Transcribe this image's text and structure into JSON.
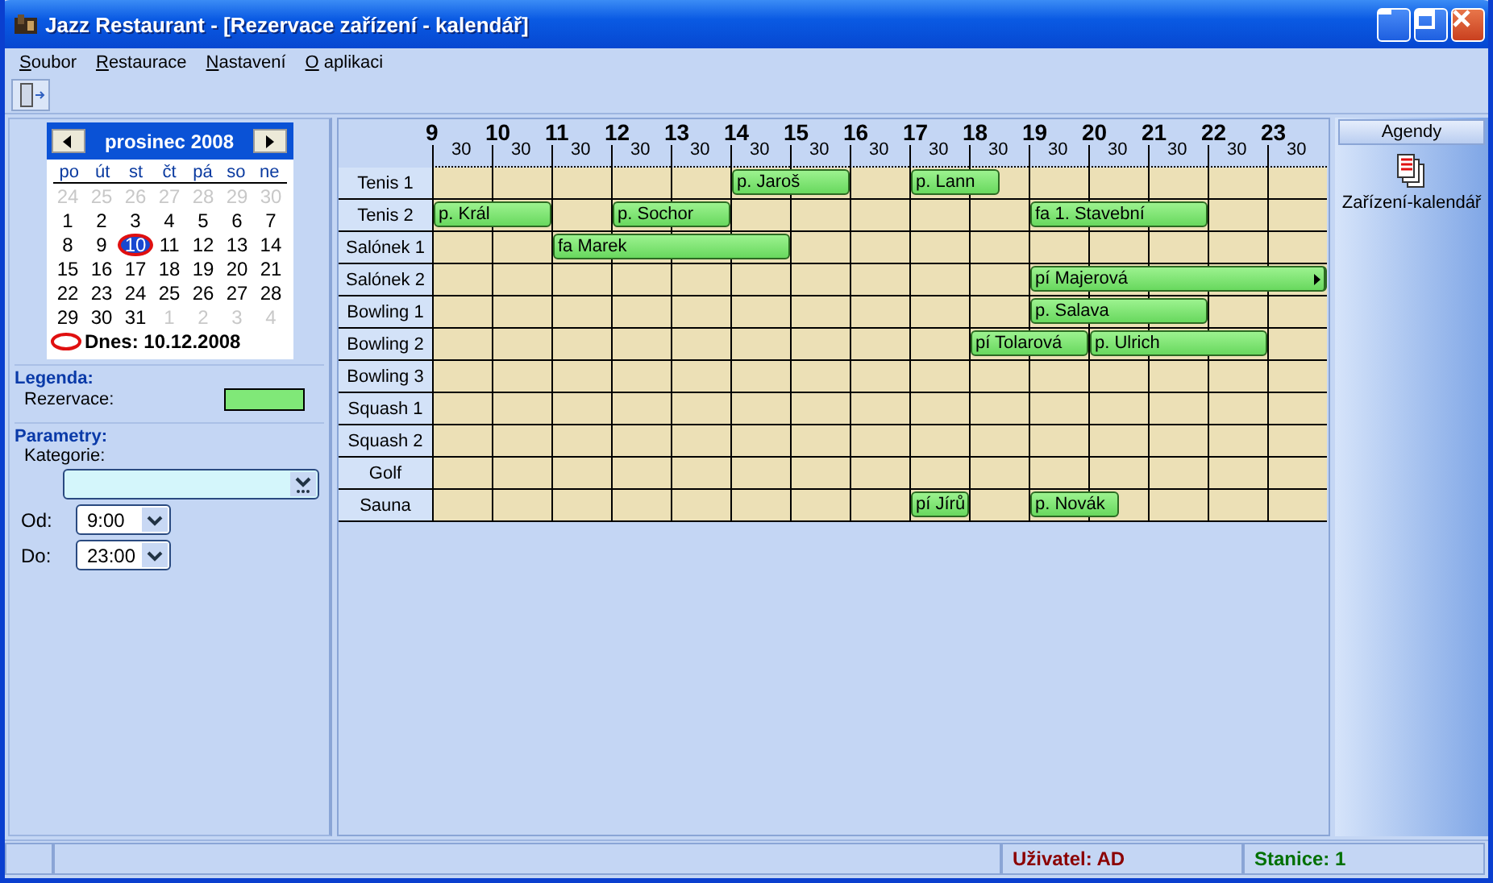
{
  "window": {
    "title": "Jazz Restaurant - [Rezervace zařízení - kalendář]"
  },
  "menu": [
    "Soubor",
    "Restaurace",
    "Nastavení",
    "O aplikaci"
  ],
  "calendar": {
    "month": "prosinec 2008",
    "weekdays": [
      "po",
      "út",
      "st",
      "čt",
      "pá",
      "so",
      "ne"
    ],
    "weeks": [
      [
        {
          "day": "24",
          "other_month": true,
          "selected": false
        },
        {
          "day": "25",
          "other_month": true,
          "selected": false
        },
        {
          "day": "26",
          "other_month": true,
          "selected": false
        },
        {
          "day": "27",
          "other_month": true,
          "selected": false
        },
        {
          "day": "28",
          "other_month": true,
          "selected": false
        },
        {
          "day": "29",
          "other_month": true,
          "selected": false
        },
        {
          "day": "30",
          "other_month": true,
          "selected": false
        }
      ],
      [
        {
          "day": "1",
          "other_month": false,
          "selected": false
        },
        {
          "day": "2",
          "other_month": false,
          "selected": false
        },
        {
          "day": "3",
          "other_month": false,
          "selected": false
        },
        {
          "day": "4",
          "other_month": false,
          "selected": false
        },
        {
          "day": "5",
          "other_month": false,
          "selected": false
        },
        {
          "day": "6",
          "other_month": false,
          "selected": false
        },
        {
          "day": "7",
          "other_month": false,
          "selected": false
        }
      ],
      [
        {
          "day": "8",
          "other_month": false,
          "selected": false
        },
        {
          "day": "9",
          "other_month": false,
          "selected": false
        },
        {
          "day": "10",
          "other_month": false,
          "selected": true
        },
        {
          "day": "11",
          "other_month": false,
          "selected": false
        },
        {
          "day": "12",
          "other_month": false,
          "selected": false
        },
        {
          "day": "13",
          "other_month": false,
          "selected": false
        },
        {
          "day": "14",
          "other_month": false,
          "selected": false
        }
      ],
      [
        {
          "day": "15",
          "other_month": false,
          "selected": false
        },
        {
          "day": "16",
          "other_month": false,
          "selected": false
        },
        {
          "day": "17",
          "other_month": false,
          "selected": false
        },
        {
          "day": "18",
          "other_month": false,
          "selected": false
        },
        {
          "day": "19",
          "other_month": false,
          "selected": false
        },
        {
          "day": "20",
          "other_month": false,
          "selected": false
        },
        {
          "day": "21",
          "other_month": false,
          "selected": false
        }
      ],
      [
        {
          "day": "22",
          "other_month": false,
          "selected": false
        },
        {
          "day": "23",
          "other_month": false,
          "selected": false
        },
        {
          "day": "24",
          "other_month": false,
          "selected": false
        },
        {
          "day": "25",
          "other_month": false,
          "selected": false
        },
        {
          "day": "26",
          "other_month": false,
          "selected": false
        },
        {
          "day": "27",
          "other_month": false,
          "selected": false
        },
        {
          "day": "28",
          "other_month": false,
          "selected": false
        }
      ],
      [
        {
          "day": "29",
          "other_month": false,
          "selected": false
        },
        {
          "day": "30",
          "other_month": false,
          "selected": false
        },
        {
          "day": "31",
          "other_month": false,
          "selected": false
        },
        {
          "day": "1",
          "other_month": true,
          "selected": false
        },
        {
          "day": "2",
          "other_month": true,
          "selected": false
        },
        {
          "day": "3",
          "other_month": true,
          "selected": false
        },
        {
          "day": "4",
          "other_month": true,
          "selected": false
        }
      ]
    ],
    "today": "Dnes: 10.12.2008"
  },
  "legend": {
    "title": "Legenda:",
    "items": [
      {
        "label": "Rezervace:",
        "color": "#80e878"
      }
    ]
  },
  "parameters": {
    "title": "Parametry:",
    "category_label": "Kategorie:",
    "from_label": "Od:",
    "from_value": "9:00",
    "to_label": "Do:",
    "to_value": "23:00"
  },
  "schedule": {
    "hours": [
      {
        "hour": "9",
        "half": "30"
      },
      {
        "hour": "10",
        "half": "30"
      },
      {
        "hour": "11",
        "half": "30"
      },
      {
        "hour": "12",
        "half": "30"
      },
      {
        "hour": "13",
        "half": "30"
      },
      {
        "hour": "14",
        "half": "30"
      },
      {
        "hour": "15",
        "half": "30"
      },
      {
        "hour": "16",
        "half": "30"
      },
      {
        "hour": "17",
        "half": "30"
      },
      {
        "hour": "18",
        "half": "30"
      },
      {
        "hour": "19",
        "half": "30"
      },
      {
        "hour": "20",
        "half": "30"
      },
      {
        "hour": "21",
        "half": "30"
      },
      {
        "hour": "22",
        "half": "30"
      },
      {
        "hour": "23",
        "half": "30"
      }
    ],
    "rows": [
      {
        "name": "Tenis 1",
        "reservations": [
          {
            "label": "p. Jaroš",
            "continues": false
          },
          {
            "label": "p. Lann",
            "continues": false
          }
        ]
      },
      {
        "name": "Tenis 2",
        "reservations": [
          {
            "label": "p. Král",
            "continues": false
          },
          {
            "label": "p. Sochor",
            "continues": false
          },
          {
            "label": "fa 1. Stavební",
            "continues": false
          }
        ]
      },
      {
        "name": "Salónek 1",
        "reservations": [
          {
            "label": "fa Marek",
            "continues": false
          }
        ]
      },
      {
        "name": "Salónek 2",
        "reservations": [
          {
            "label": "pí Majerová",
            "continues": true
          }
        ]
      },
      {
        "name": "Bowling 1",
        "reservations": [
          {
            "label": "p. Salava",
            "continues": false
          }
        ]
      },
      {
        "name": "Bowling 2",
        "reservations": [
          {
            "label": "pí Tolarová",
            "continues": false
          },
          {
            "label": "p. Ulrich",
            "continues": false
          }
        ]
      },
      {
        "name": "Bowling 3",
        "reservations": []
      },
      {
        "name": "Squash 1",
        "reservations": []
      },
      {
        "name": "Squash 2",
        "reservations": []
      },
      {
        "name": "Golf",
        "reservations": []
      },
      {
        "name": "Sauna",
        "reservations": [
          {
            "label": "pí Jírů",
            "continues": false
          },
          {
            "label": "p. Novák",
            "continues": false
          }
        ]
      }
    ]
  },
  "agendas": {
    "title": "Agendy",
    "items": [
      {
        "label": "Zařízení-kalendář"
      }
    ]
  },
  "status_bar": [
    {
      "text": "Uživatel: AD",
      "color": "#8b0000"
    },
    {
      "text": "Stanice: 1",
      "color": "#007000"
    }
  ]
}
